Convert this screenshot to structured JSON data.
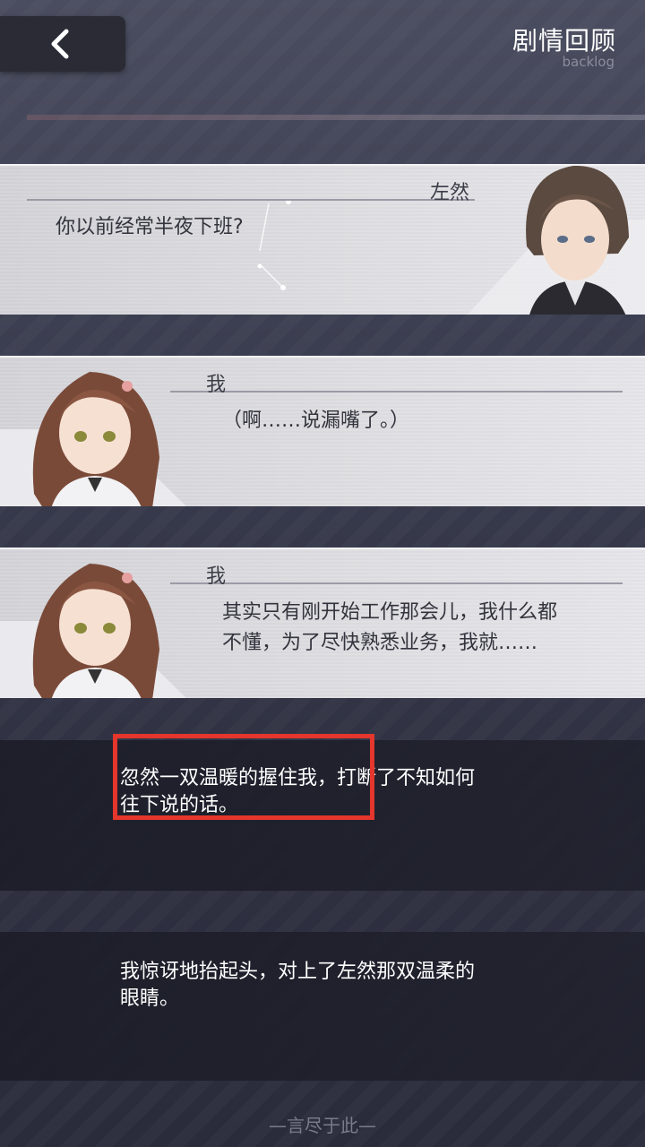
{
  "header": {
    "back_icon": "chevron-left-icon",
    "title": "剧情回顾",
    "subtitle": "backlog"
  },
  "entries": [
    {
      "speaker": "左然",
      "text": "你以前经常半夜下班?"
    },
    {
      "speaker": "我",
      "text": "（啊……说漏嘴了。）"
    },
    {
      "speaker": "我",
      "lines": [
        "其实只有刚开始工作那会儿，我什么都",
        "不懂，为了尽快熟悉业务，我就……"
      ]
    }
  ],
  "narration": [
    {
      "lines": [
        "忽然一双温暖的握住我，打断了不知如何",
        "往下说的话。"
      ]
    },
    {
      "lines": [
        "我惊讶地抬起头，对上了左然那双温柔的",
        "眼睛。"
      ]
    }
  ],
  "footer": "—言尽于此—",
  "colors": {
    "highlight": "#e4362c",
    "card_bg": "#dcdce0"
  }
}
